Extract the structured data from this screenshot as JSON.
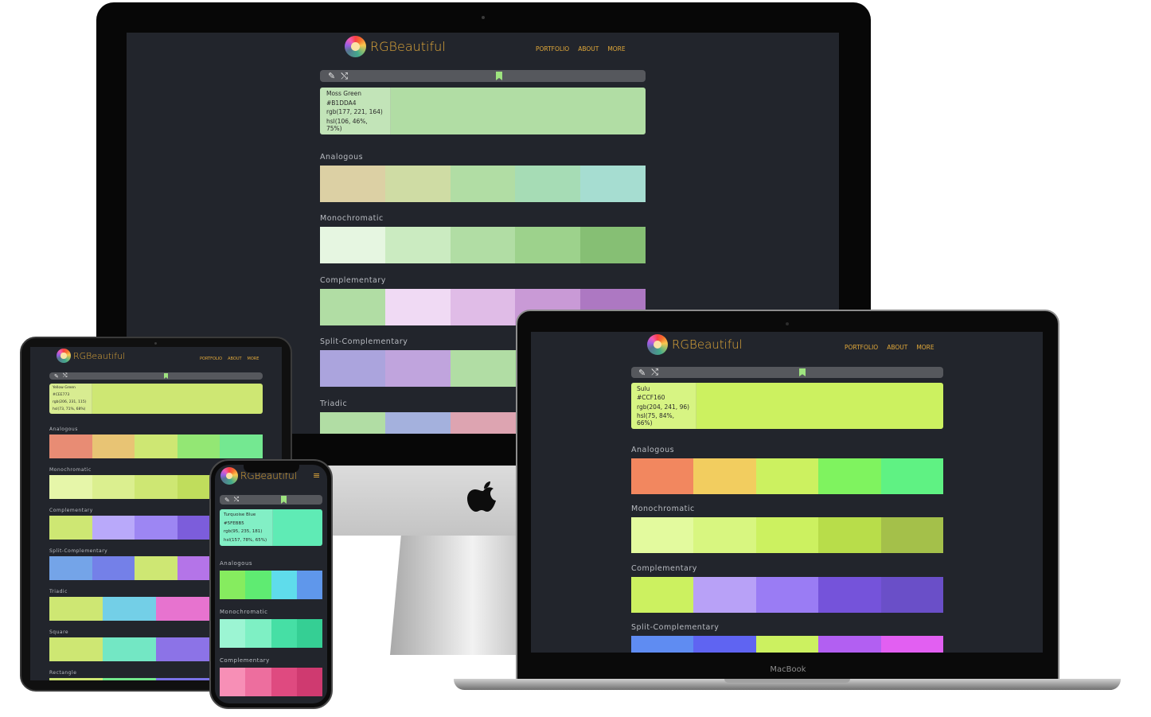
{
  "app": {
    "logo_text": "RGBeautiful",
    "nav": [
      "PORTFOLIO",
      "ABOUT",
      "MORE"
    ],
    "brand_color": "#e2a93a",
    "background": "#22252c"
  },
  "icons": {
    "picker": "pencil-icon",
    "shuffle": "shuffle-icon",
    "bookmark": "bookmark-icon",
    "menu": "hamburger-icon"
  },
  "toolbar_glyphs": {
    "picker": "✎",
    "shuffle": "⤭",
    "menu": "≡"
  },
  "laptop_label": "MacBook",
  "desktop": {
    "color": {
      "name": "Moss Green",
      "hex": "#B1DDA4",
      "rgb": "rgb(177, 221, 164)",
      "hsl": "hsl(106, 46%, 75%)",
      "swatch": "#b1dda4"
    },
    "schemes": [
      {
        "label": "Analogous",
        "colors": [
          "#dcd0a4",
          "#cfdca4",
          "#b1dda4",
          "#a6dcb5",
          "#a6ddd1"
        ]
      },
      {
        "label": "Monochromatic",
        "colors": [
          "#e6f6e1",
          "#cbebc1",
          "#b1dda4",
          "#9dd28c",
          "#86bf74"
        ]
      },
      {
        "label": "Complementary",
        "colors": [
          "#b1dda4",
          "#f0daf4",
          "#e0bce7",
          "#c99ad6",
          "#ad78c2"
        ]
      },
      {
        "label": "Split-Complementary",
        "colors": [
          "#aba4dd",
          "#c0a4dd",
          "#b1dda4",
          "#a4dd99",
          "#a4dda0"
        ]
      },
      {
        "label": "Triadic",
        "colors": [
          "#b1dda4",
          "#a4b1dd",
          "#dda4b1",
          "#dda4b1",
          "#dda4b1"
        ]
      }
    ]
  },
  "laptop": {
    "color": {
      "name": "Sulu",
      "hex": "#CCF160",
      "rgb": "rgb(204, 241, 96)",
      "hsl": "hsl(75, 84%, 66%)",
      "swatch": "#ccf160"
    },
    "schemes": [
      {
        "label": "Analogous",
        "colors": [
          "#f2875f",
          "#f2cd5f",
          "#ccf160",
          "#7ff35f",
          "#5ff283"
        ]
      },
      {
        "label": "Monochromatic",
        "colors": [
          "#e3fa9e",
          "#d8f680",
          "#ccf160",
          "#b8dd4a",
          "#a4c04a"
        ]
      },
      {
        "label": "Complementary",
        "colors": [
          "#ccf160",
          "#b8a1f7",
          "#9a7cf4",
          "#7553da",
          "#6a4fc8"
        ]
      },
      {
        "label": "Split-Complementary",
        "colors": [
          "#5f8cf2",
          "#5f64f2",
          "#ccf160",
          "#b25ff2",
          "#e25ff2"
        ]
      }
    ]
  },
  "tablet": {
    "color": {
      "name": "Yellow Green",
      "hex": "#CEE773",
      "rgb": "rgb(206, 231, 115)",
      "hsl": "hsl(73, 71%, 68%)",
      "swatch": "#cee773"
    },
    "schemes": [
      {
        "label": "Analogous",
        "colors": [
          "#e88c74",
          "#e8c474",
          "#cee773",
          "#93e774",
          "#74e891"
        ]
      },
      {
        "label": "Monochromatic",
        "colors": [
          "#e6f6a9",
          "#dbef8f",
          "#cee773",
          "#c0dd5c",
          "#a8c449"
        ]
      },
      {
        "label": "Complementary",
        "colors": [
          "#cee773",
          "#b9a9fa",
          "#9d86f3",
          "#7c5ddb",
          "#6a4cc7"
        ]
      },
      {
        "label": "Split-Complementary",
        "colors": [
          "#74a4e8",
          "#7480e8",
          "#cee773",
          "#b474e8",
          "#e074e8"
        ]
      },
      {
        "label": "Triadic",
        "colors": [
          "#cee773",
          "#73cfe7",
          "#e773cf",
          "#e773cf"
        ]
      },
      {
        "label": "Square",
        "colors": [
          "#cee773",
          "#73e7c4",
          "#8c73e7",
          "#e7739b"
        ]
      },
      {
        "label": "Rectangle",
        "colors": [
          "#cee773",
          "#73e78c",
          "#7a73e7",
          "#e773ce"
        ]
      }
    ]
  },
  "phone": {
    "color": {
      "name": "Turquoise Blue",
      "hex": "#5FEBB5",
      "rgb": "rgb(95, 235, 181)",
      "hsl": "hsl(157, 78%, 65%)",
      "swatch": "#5febb5"
    },
    "schemes": [
      {
        "label": "Analogous",
        "colors": [
          "#86ec5f",
          "#5feb72",
          "#5fdceb",
          "#5f97eb"
        ]
      },
      {
        "label": "Monochromatic",
        "colors": [
          "#9cf5d3",
          "#7ef0c4",
          "#46dfa5",
          "#35cf94"
        ]
      },
      {
        "label": "Complementary",
        "colors": [
          "#f78fb6",
          "#ed6e9e",
          "#df4a80",
          "#cf3a70"
        ]
      }
    ]
  }
}
